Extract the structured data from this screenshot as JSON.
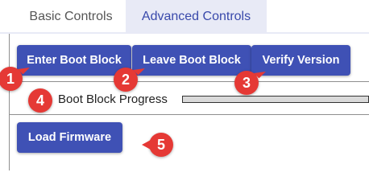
{
  "tabs": [
    {
      "label": "Basic Controls",
      "active": false
    },
    {
      "label": "Advanced Controls",
      "active": true
    }
  ],
  "buttons": {
    "enter_boot_block": "Enter Boot Block",
    "leave_boot_block": "Leave Boot Block",
    "verify_version": "Verify Version",
    "load_firmware": "Load Firmware"
  },
  "progress": {
    "label": "Boot Block Progress",
    "value_percent": 0
  },
  "annotations": [
    "1",
    "2",
    "3",
    "4",
    "5"
  ],
  "colors": {
    "primary": "#3f51b5",
    "active_tab_bg": "#e8eaf6",
    "badge": "#e53935"
  }
}
